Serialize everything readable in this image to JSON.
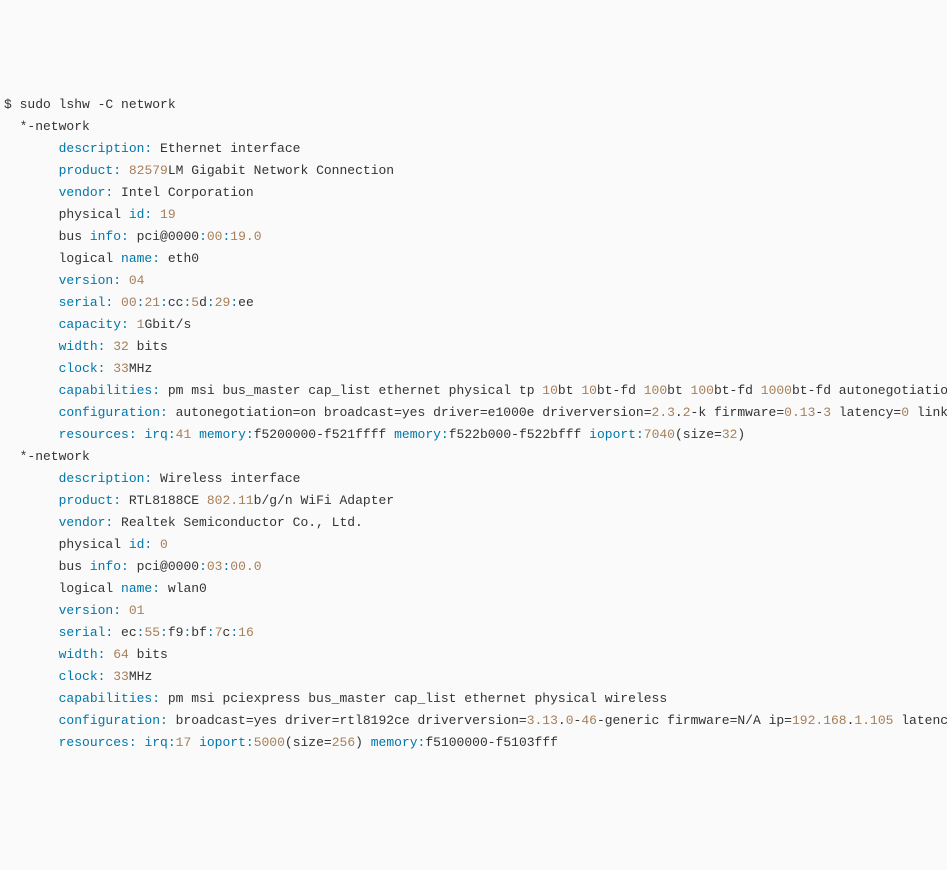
{
  "prompt": "$ ",
  "command": "sudo lshw -C network",
  "networks": [
    {
      "header": "  *-network",
      "indent": "       ",
      "lines": [
        {
          "key": "description:",
          "parts": [
            {
              "t": " Ethernet interface"
            }
          ]
        },
        {
          "key": "product:",
          "parts": [
            {
              "t": " ",
              "c": "num"
            },
            {
              "t": "82579",
              "c": "num"
            },
            {
              "t": "LM Gigabit Network Connection"
            }
          ]
        },
        {
          "key": "vendor:",
          "parts": [
            {
              "t": " Intel Corporation"
            }
          ]
        },
        {
          "key": null,
          "raw_start": "physical ",
          "raw_key": "id:",
          "parts": [
            {
              "t": " ",
              "c": ""
            },
            {
              "t": "19",
              "c": "num"
            }
          ]
        },
        {
          "key": null,
          "raw_start": "bus ",
          "raw_key": "info:",
          "parts": [
            {
              "t": " pci@0000"
            },
            {
              "t": ":",
              "c": "key"
            },
            {
              "t": "00",
              "c": "num"
            },
            {
              "t": ":",
              "c": "key"
            },
            {
              "t": "19.0",
              "c": "num"
            }
          ]
        },
        {
          "key": null,
          "raw_start": "logical ",
          "raw_key": "name:",
          "parts": [
            {
              "t": " eth0"
            }
          ]
        },
        {
          "key": "version:",
          "parts": [
            {
              "t": " ",
              "c": ""
            },
            {
              "t": "04",
              "c": "num"
            }
          ]
        },
        {
          "key": "serial:",
          "parts": [
            {
              "t": " ",
              "c": ""
            },
            {
              "t": "00",
              "c": "num"
            },
            {
              "t": ":",
              "c": "key"
            },
            {
              "t": "21",
              "c": "num"
            },
            {
              "t": ":",
              "c": "key"
            },
            {
              "t": "cc"
            },
            {
              "t": ":",
              "c": "key"
            },
            {
              "t": "5",
              "c": "num"
            },
            {
              "t": "d"
            },
            {
              "t": ":",
              "c": "key"
            },
            {
              "t": "29",
              "c": "num"
            },
            {
              "t": ":",
              "c": "key"
            },
            {
              "t": "ee"
            }
          ]
        },
        {
          "key": "capacity:",
          "parts": [
            {
              "t": " ",
              "c": ""
            },
            {
              "t": "1",
              "c": "num"
            },
            {
              "t": "Gbit/s"
            }
          ]
        },
        {
          "key": "width:",
          "parts": [
            {
              "t": " ",
              "c": ""
            },
            {
              "t": "32",
              "c": "num"
            },
            {
              "t": " bits"
            }
          ]
        },
        {
          "key": "clock:",
          "parts": [
            {
              "t": " ",
              "c": ""
            },
            {
              "t": "33",
              "c": "num"
            },
            {
              "t": "MHz"
            }
          ]
        },
        {
          "key": "capabilities:",
          "parts": [
            {
              "t": " pm msi bus_master cap_list ethernet physical tp "
            },
            {
              "t": "10",
              "c": "num"
            },
            {
              "t": "bt "
            },
            {
              "t": "10",
              "c": "num"
            },
            {
              "t": "bt-fd "
            },
            {
              "t": "100",
              "c": "num"
            },
            {
              "t": "bt "
            },
            {
              "t": "100",
              "c": "num"
            },
            {
              "t": "bt-fd "
            },
            {
              "t": "1000",
              "c": "num"
            },
            {
              "t": "bt-fd autonegotiation"
            }
          ]
        },
        {
          "key": "configuration:",
          "parts": [
            {
              "t": " autonegotiation=on broadcast=yes driver=e1000e driverversion="
            },
            {
              "t": "2.3",
              "c": "num"
            },
            {
              "t": "."
            },
            {
              "t": "2",
              "c": "num"
            },
            {
              "t": "-k firmware="
            },
            {
              "t": "0.13",
              "c": "num"
            },
            {
              "t": "-"
            },
            {
              "t": "3",
              "c": "num"
            },
            {
              "t": " latency="
            },
            {
              "t": "0",
              "c": "num"
            },
            {
              "t": " link="
            }
          ]
        },
        {
          "key": "resources:",
          "parts": [
            {
              "t": " "
            },
            {
              "t": "irq:",
              "c": "key"
            },
            {
              "t": "41",
              "c": "num"
            },
            {
              "t": " "
            },
            {
              "t": "memory:",
              "c": "key"
            },
            {
              "t": "f5200000-f521ffff "
            },
            {
              "t": "memory:",
              "c": "key"
            },
            {
              "t": "f522b000-f522bfff "
            },
            {
              "t": "ioport:",
              "c": "key"
            },
            {
              "t": "7040",
              "c": "num"
            },
            {
              "t": "(size="
            },
            {
              "t": "32",
              "c": "num"
            },
            {
              "t": ")"
            }
          ]
        }
      ]
    },
    {
      "header": "  *-network",
      "indent": "       ",
      "lines": [
        {
          "key": "description:",
          "parts": [
            {
              "t": " Wireless interface"
            }
          ]
        },
        {
          "key": "product:",
          "parts": [
            {
              "t": " RTL8188CE "
            },
            {
              "t": "802.11",
              "c": "num"
            },
            {
              "t": "b/g/n WiFi Adapter"
            }
          ]
        },
        {
          "key": "vendor:",
          "parts": [
            {
              "t": " Realtek Semiconductor Co., Ltd."
            }
          ]
        },
        {
          "key": null,
          "raw_start": "physical ",
          "raw_key": "id:",
          "parts": [
            {
              "t": " ",
              "c": ""
            },
            {
              "t": "0",
              "c": "num"
            }
          ]
        },
        {
          "key": null,
          "raw_start": "bus ",
          "raw_key": "info:",
          "parts": [
            {
              "t": " pci@0000"
            },
            {
              "t": ":",
              "c": "key"
            },
            {
              "t": "03",
              "c": "num"
            },
            {
              "t": ":",
              "c": "key"
            },
            {
              "t": "00.0",
              "c": "num"
            }
          ]
        },
        {
          "key": null,
          "raw_start": "logical ",
          "raw_key": "name:",
          "parts": [
            {
              "t": " wlan0"
            }
          ]
        },
        {
          "key": "version:",
          "parts": [
            {
              "t": " ",
              "c": ""
            },
            {
              "t": "01",
              "c": "num"
            }
          ]
        },
        {
          "key": "serial:",
          "parts": [
            {
              "t": " ec"
            },
            {
              "t": ":",
              "c": "key"
            },
            {
              "t": "55",
              "c": "num"
            },
            {
              "t": ":",
              "c": "key"
            },
            {
              "t": "f9"
            },
            {
              "t": ":",
              "c": "key"
            },
            {
              "t": "bf"
            },
            {
              "t": ":",
              "c": "key"
            },
            {
              "t": "7",
              "c": "num"
            },
            {
              "t": "c"
            },
            {
              "t": ":",
              "c": "key"
            },
            {
              "t": "16",
              "c": "num"
            }
          ]
        },
        {
          "key": "width:",
          "parts": [
            {
              "t": " ",
              "c": ""
            },
            {
              "t": "64",
              "c": "num"
            },
            {
              "t": " bits"
            }
          ]
        },
        {
          "key": "clock:",
          "parts": [
            {
              "t": " ",
              "c": ""
            },
            {
              "t": "33",
              "c": "num"
            },
            {
              "t": "MHz"
            }
          ]
        },
        {
          "key": "capabilities:",
          "parts": [
            {
              "t": " pm msi pciexpress bus_master cap_list ethernet physical wireless"
            }
          ]
        },
        {
          "key": "configuration:",
          "parts": [
            {
              "t": " broadcast=yes driver=rtl8192ce driverversion="
            },
            {
              "t": "3.13",
              "c": "num"
            },
            {
              "t": "."
            },
            {
              "t": "0",
              "c": "num"
            },
            {
              "t": "-"
            },
            {
              "t": "46",
              "c": "num"
            },
            {
              "t": "-generic firmware=N/A ip="
            },
            {
              "t": "192.168",
              "c": "num"
            },
            {
              "t": "."
            },
            {
              "t": "1.105",
              "c": "num"
            },
            {
              "t": " latency"
            }
          ]
        },
        {
          "key": "resources:",
          "parts": [
            {
              "t": " "
            },
            {
              "t": "irq:",
              "c": "key"
            },
            {
              "t": "17",
              "c": "num"
            },
            {
              "t": " "
            },
            {
              "t": "ioport:",
              "c": "key"
            },
            {
              "t": "5000",
              "c": "num"
            },
            {
              "t": "(size="
            },
            {
              "t": "256",
              "c": "num"
            },
            {
              "t": ") "
            },
            {
              "t": "memory:",
              "c": "key"
            },
            {
              "t": "f5100000-f5103fff"
            }
          ]
        }
      ]
    }
  ]
}
